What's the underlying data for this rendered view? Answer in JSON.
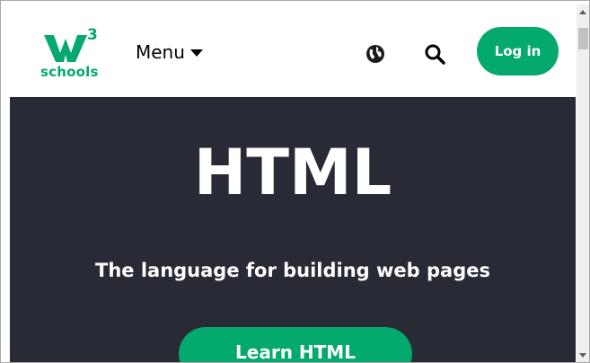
{
  "header": {
    "logo": {
      "superscript": "3",
      "text": "schools"
    },
    "menu_label": "Menu",
    "login_label": "Log in"
  },
  "hero": {
    "title": "HTML",
    "subtitle": "The language for building web pages",
    "cta_label": "Learn HTML"
  },
  "colors": {
    "brand_green": "#04AA6D",
    "hero_background": "#282A35",
    "header_background": "#FFFFFF"
  },
  "icons": {
    "logo": "w3schools-logo-icon",
    "menu_caret": "caret-down-icon",
    "language": "globe-icon",
    "search": "search-icon"
  }
}
